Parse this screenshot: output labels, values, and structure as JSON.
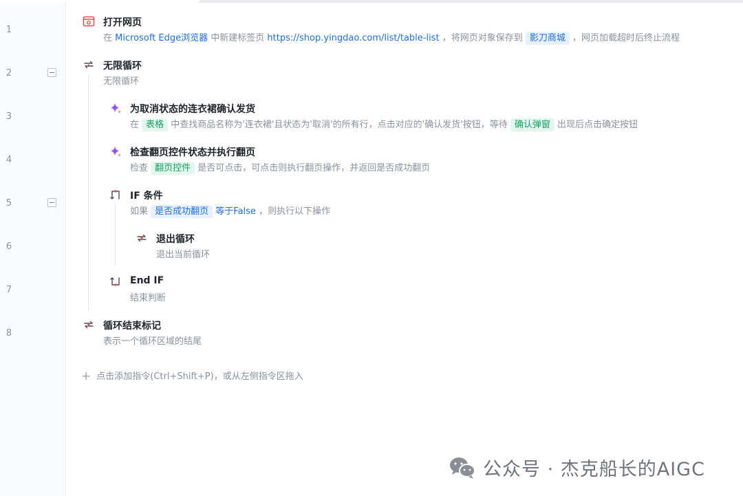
{
  "line_numbers": [
    "1",
    "2",
    "3",
    "4",
    "5",
    "6",
    "7",
    "8"
  ],
  "steps": {
    "open_page": {
      "title": "打开网页",
      "desc": {
        "p1": "在 ",
        "browser": "Microsoft Edge浏览器",
        "p2": " 中新建标签页 ",
        "url": "https://shop.yingdao.com/list/table-list",
        "p3": " ，将网页对象保存到 ",
        "var": "影刀商城",
        "p4": " ，网页加载超时后终止流程"
      }
    },
    "infinite_loop": {
      "title": "无限循环",
      "desc": "无限循环"
    },
    "confirm_ship": {
      "title": "为取消状态的连衣裙确认发货",
      "desc": {
        "p1": "在 ",
        "chip1": "表格",
        "p2": " 中查找商品名称为'连衣裙'且状态为'取消'的所有行，点击对应的'确认发货'按钮，等待 ",
        "chip2": "确认弹窗",
        "p3": " 出现后点击确定按钮"
      }
    },
    "check_pager": {
      "title": "检查翻页控件状态并执行翻页",
      "desc": {
        "p1": "检查 ",
        "chip1": "翻页控件",
        "p2": " 是否可点击，可点击则执行翻页操作，并返回是否成功翻页"
      }
    },
    "if_cond": {
      "title": "IF 条件",
      "desc": {
        "p1": "如果 ",
        "chip1": "是否成功翻页",
        "op": " 等于False",
        "p2": " ，则执行以下操作"
      }
    },
    "exit_loop": {
      "title": "退出循环",
      "desc": "退出当前循环"
    },
    "end_if": {
      "title": "End IF",
      "desc": "结束判断"
    },
    "loop_end": {
      "title": "循环结束标记",
      "desc": "表示一个循环区域的结尾"
    }
  },
  "add_command": {
    "plus": "+",
    "text": "点击添加指令(Ctrl+Shift+P)，或从左侧指令区拖入"
  },
  "watermark": {
    "text": "公众号 · 杰克船长的AIGC",
    "icon": "wechat-icon"
  },
  "colors": {
    "link": "#1e6fe8",
    "chip_green": "#14a064",
    "ai_purple": "#9b4dff",
    "loop_red": "#e5484d"
  }
}
